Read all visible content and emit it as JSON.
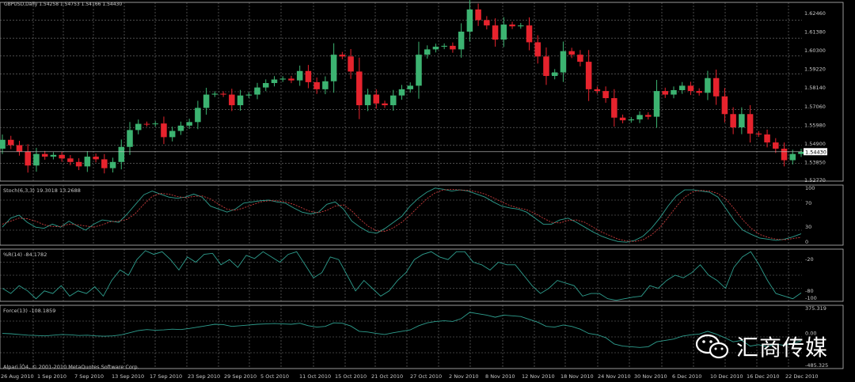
{
  "chart_data": {
    "type": "candlestick",
    "symbol_header": "GBPUSD,Daily 1.54258 1.54753 1.54166 1.54430",
    "copyright": "Alpari ÎÒ4, © 2001-2010 MetaQuotes Software Corp.",
    "price_axis": {
      "ticks": [
        "1.62460",
        "1.61380",
        "1.60300",
        "1.59220",
        "1.58140",
        "1.57060",
        "1.55980",
        "1.54900",
        "1.53850",
        "1.52770"
      ],
      "ylim": [
        1.5277,
        1.6285
      ],
      "current_price": "1.54430",
      "current_value": 1.5443
    },
    "x_ticks": [
      "26 Aug 2010",
      "1 Sep 2010",
      "7 Sep 2010",
      "13 Sep 2010",
      "17 Sep 2010",
      "23 Sep 2010",
      "29 Sep 2010",
      "5 Oct 2010",
      "11 Oct 2010",
      "15 Oct 2010",
      "21 Oct 2010",
      "27 Oct 2010",
      "2 Nov 2010",
      "8 Nov 2010",
      "12 Nov 2010",
      "18 Nov 2010",
      "24 Nov 2010",
      "30 Nov 2010",
      "6 Dec 2010",
      "10 Dec 2010",
      "16 Dec 2010",
      "22 Dec 2010"
    ],
    "candles": {
      "close": [
        1.551,
        1.548,
        1.5445,
        1.5365,
        1.543,
        1.5415,
        1.5425,
        1.5405,
        1.5385,
        1.536,
        1.5415,
        1.54,
        1.535,
        1.5385,
        1.547,
        1.5565,
        1.56,
        1.5598,
        1.5602,
        1.5525,
        1.556,
        1.559,
        1.561,
        1.569,
        1.5765,
        1.577,
        1.5765,
        1.5705,
        1.576,
        1.5765,
        1.5805,
        1.583,
        1.585,
        1.5855,
        1.5845,
        1.5898,
        1.5835,
        1.5795,
        1.584,
        1.599,
        1.598,
        1.5895,
        1.5705,
        1.5765,
        1.5715,
        1.5705,
        1.576,
        1.5795,
        1.5815,
        1.599,
        1.602,
        1.6035,
        1.604,
        1.602,
        1.612,
        1.6245,
        1.6185,
        1.6155,
        1.6075,
        1.616,
        1.615,
        1.6155,
        1.606,
        1.598,
        1.587,
        1.589,
        1.601,
        1.599,
        1.595,
        1.5795,
        1.5785,
        1.5745,
        1.5635,
        1.562,
        1.5625,
        1.565,
        1.564,
        1.5785,
        1.5765,
        1.579,
        1.5815,
        1.5785,
        1.5775,
        1.5858,
        1.5755,
        1.5655,
        1.558,
        1.5655,
        1.5545,
        1.554,
        1.5495,
        1.546,
        1.5395,
        1.543,
        1.5443
      ],
      "open": [
        1.546,
        1.551,
        1.548,
        1.5445,
        1.5365,
        1.543,
        1.5415,
        1.5425,
        1.5405,
        1.5385,
        1.536,
        1.5415,
        1.54,
        1.535,
        1.5385,
        1.547,
        1.5565,
        1.56,
        1.5598,
        1.5602,
        1.5525,
        1.556,
        1.559,
        1.561,
        1.569,
        1.5765,
        1.577,
        1.5765,
        1.5705,
        1.576,
        1.5765,
        1.5805,
        1.583,
        1.585,
        1.5855,
        1.5845,
        1.5898,
        1.5835,
        1.5795,
        1.584,
        1.599,
        1.598,
        1.5895,
        1.5705,
        1.5765,
        1.5715,
        1.5705,
        1.576,
        1.5795,
        1.5815,
        1.599,
        1.602,
        1.6035,
        1.604,
        1.602,
        1.612,
        1.6245,
        1.6185,
        1.6155,
        1.6075,
        1.616,
        1.615,
        1.6155,
        1.606,
        1.598,
        1.587,
        1.589,
        1.601,
        1.599,
        1.595,
        1.5795,
        1.5785,
        1.5745,
        1.5635,
        1.562,
        1.5625,
        1.565,
        1.564,
        1.5785,
        1.5765,
        1.579,
        1.5815,
        1.5785,
        1.5775,
        1.5858,
        1.5755,
        1.5655,
        1.558,
        1.5655,
        1.5545,
        1.554,
        1.5495,
        1.546,
        1.5395,
        1.543
      ]
    },
    "panels": [
      {
        "label": "Stoch(6,3,3) 19.3018 13.2688",
        "ticks": [
          "100",
          "70",
          "30",
          "0"
        ],
        "ylim": [
          0,
          100
        ],
        "series": [
          {
            "color": "#2e9e8e",
            "values": [
              30,
              45,
              50,
              38,
              30,
              28,
              35,
              30,
              40,
              32,
              25,
              35,
              42,
              40,
              38,
              52,
              68,
              84,
              90,
              85,
              80,
              78,
              80,
              85,
              80,
              65,
              60,
              55,
              60,
              70,
              72,
              74,
              75,
              72,
              70,
              62,
              55,
              52,
              55,
              68,
              72,
              60,
              40,
              30,
              22,
              20,
              28,
              38,
              48,
              65,
              78,
              88,
              95,
              93,
              90,
              92,
              90,
              85,
              80,
              72,
              65,
              62,
              60,
              55,
              45,
              35,
              35,
              42,
              45,
              38,
              30,
              22,
              15,
              10,
              6,
              5,
              8,
              15,
              28,
              45,
              65,
              82,
              92,
              92,
              90,
              88,
              80,
              60,
              40,
              25,
              18,
              12,
              10,
              8,
              10,
              14,
              19
            ]
          },
          {
            "color": "#c83c3c",
            "values": [
              35,
              40,
              45,
              44,
              40,
              34,
              31,
              31,
              35,
              34,
              32,
              30,
              34,
              39,
              40,
              43,
              53,
              68,
              81,
              86,
              85,
              81,
              79,
              81,
              82,
              77,
              68,
              60,
              58,
              62,
              67,
              72,
              74,
              74,
              72,
              68,
              62,
              56,
              54,
              58,
              65,
              67,
              57,
              43,
              31,
              24,
              23,
              29,
              38,
              50,
              64,
              77,
              87,
              92,
              93,
              92,
              91,
              89,
              85,
              79,
              72,
              66,
              62,
              59,
              53,
              45,
              38,
              37,
              41,
              42,
              38,
              30,
              22,
              16,
              10,
              7,
              6,
              9,
              17,
              29,
              46,
              64,
              80,
              89,
              91,
              90,
              86,
              76,
              60,
              42,
              28,
              18,
              13,
              10,
              9,
              11,
              13
            ]
          }
        ]
      },
      {
        "label": "%R(14) -84.1782",
        "ticks": [
          "-20",
          "-80",
          "-100"
        ],
        "ylim": [
          -100,
          0
        ],
        "series": [
          {
            "color": "#2e9e8e",
            "values": [
              -75,
              -85,
              -70,
              -80,
              -95,
              -80,
              -85,
              -70,
              -90,
              -80,
              -85,
              -72,
              -90,
              -60,
              -40,
              -50,
              -20,
              -3,
              -10,
              -5,
              -20,
              -40,
              -15,
              -25,
              -10,
              -8,
              -30,
              -20,
              -35,
              -12,
              -18,
              -5,
              -15,
              -25,
              -10,
              -5,
              -30,
              -55,
              -45,
              -15,
              -20,
              -50,
              -80,
              -60,
              -75,
              -90,
              -80,
              -60,
              -45,
              -20,
              -10,
              -5,
              -15,
              -20,
              -5,
              -5,
              -25,
              -30,
              -40,
              -25,
              -30,
              -30,
              -50,
              -70,
              -85,
              -75,
              -60,
              -65,
              -70,
              -90,
              -85,
              -85,
              -95,
              -98,
              -95,
              -92,
              -90,
              -70,
              -75,
              -60,
              -50,
              -55,
              -45,
              -30,
              -50,
              -60,
              -75,
              -35,
              -15,
              -5,
              -30,
              -60,
              -85,
              -90,
              -95,
              -84
            ]
          }
        ]
      },
      {
        "label": "Force(13) -108.1859",
        "ticks": [
          "375.319",
          "0.00",
          "-485.325"
        ],
        "ylim": [
          -500,
          400
        ],
        "series": [
          {
            "color": "#2e9e8e",
            "values": [
              0,
              -5,
              -15,
              -25,
              -30,
              -35,
              -25,
              -15,
              -20,
              -30,
              -25,
              -35,
              -40,
              -35,
              -20,
              10,
              40,
              55,
              45,
              50,
              60,
              55,
              70,
              90,
              110,
              130,
              125,
              100,
              110,
              120,
              130,
              135,
              140,
              135,
              130,
              145,
              110,
              90,
              100,
              150,
              145,
              105,
              30,
              20,
              0,
              -15,
              10,
              30,
              50,
              110,
              150,
              170,
              180,
              170,
              210,
              300,
              280,
              260,
              230,
              260,
              250,
              240,
              200,
              160,
              100,
              90,
              120,
              100,
              60,
              0,
              -20,
              -60,
              -150,
              -180,
              -190,
              -200,
              -190,
              -120,
              -100,
              -80,
              -40,
              -20,
              -10,
              30,
              -10,
              -60,
              -120,
              -100,
              -180,
              -160,
              -190,
              -150,
              -170,
              -140,
              -108
            ]
          }
        ]
      }
    ]
  },
  "watermark": {
    "text": "汇商传媒",
    "icon": "wechat-icon"
  },
  "colors": {
    "bull": "#3cb371",
    "bear": "#e6232d",
    "grid": "#7a7a7a",
    "axis_text": "#c8c8c8"
  }
}
